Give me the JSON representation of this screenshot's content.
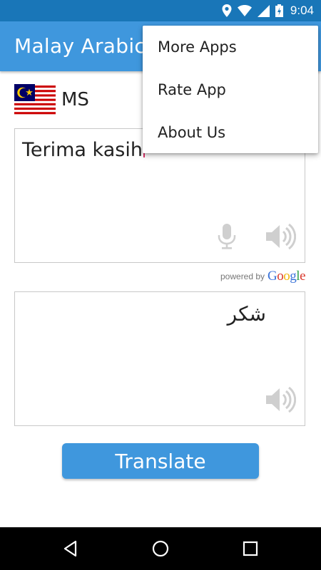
{
  "status_bar": {
    "time": "9:04",
    "icons": [
      "location-icon",
      "wifi-icon",
      "signal-icon",
      "battery-icon"
    ],
    "background": "#1976b8"
  },
  "app_bar": {
    "title": "Malay Arabic",
    "background": "#3f97dd"
  },
  "source_language": {
    "code": "MS",
    "flag": "malaysia-flag"
  },
  "input": {
    "text": "Terima kasih",
    "icons": [
      "microphone-icon",
      "speaker-icon"
    ]
  },
  "powered_by": {
    "label": "powered by",
    "brand": "Google"
  },
  "output": {
    "text": "شكر",
    "icons": [
      "speaker-icon"
    ]
  },
  "translate_button": {
    "label": "Translate"
  },
  "overflow_menu": {
    "items": [
      {
        "label": "More Apps"
      },
      {
        "label": "Rate App"
      },
      {
        "label": "About Us"
      }
    ]
  },
  "nav_bar": {
    "icons": [
      "back-icon",
      "home-icon",
      "recents-icon"
    ]
  }
}
